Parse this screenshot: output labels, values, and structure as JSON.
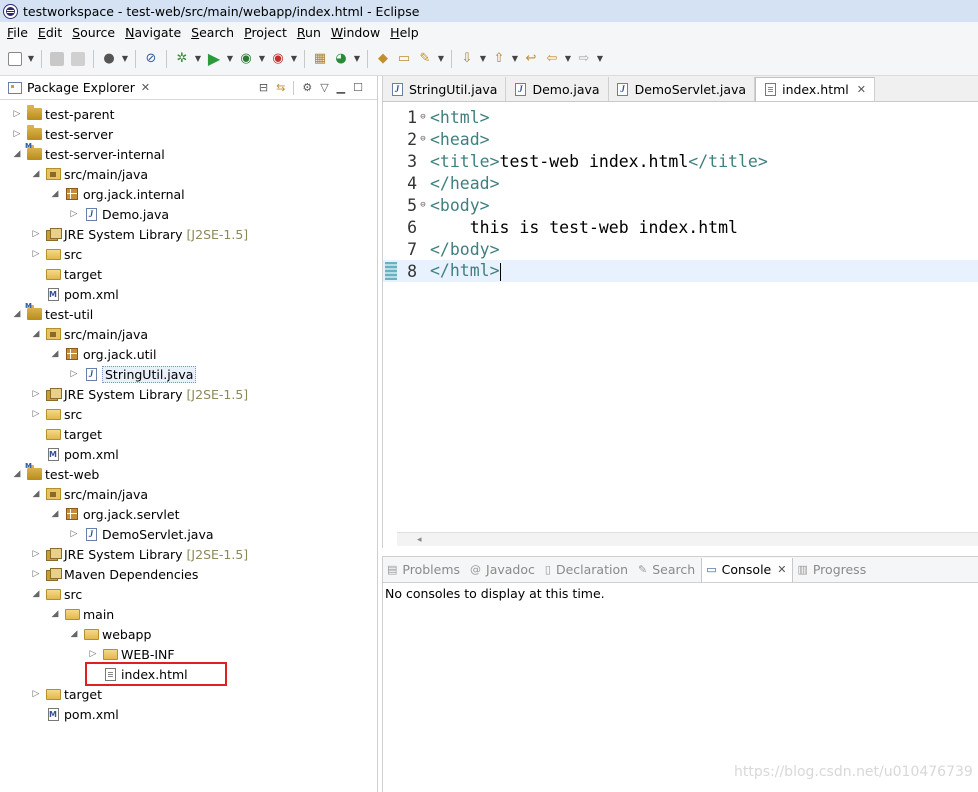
{
  "window": {
    "title": "testworkspace - test-web/src/main/webapp/index.html - Eclipse"
  },
  "menu": [
    {
      "underline": "F",
      "rest": "ile"
    },
    {
      "underline": "E",
      "rest": "dit"
    },
    {
      "underline": "S",
      "rest": "ource"
    },
    {
      "underline": "N",
      "rest": "avigate"
    },
    {
      "underline": "S",
      "rest": "earch"
    },
    {
      "underline": "P",
      "rest": "roject"
    },
    {
      "underline": "R",
      "rest": "un"
    },
    {
      "underline": "W",
      "rest": "indow"
    },
    {
      "underline": "H",
      "rest": "elp"
    }
  ],
  "package_explorer": {
    "title": "Package Explorer",
    "tree": [
      {
        "label": "test-parent",
        "depth": 0,
        "arrow": "collapsed",
        "icon": "project"
      },
      {
        "label": "test-server",
        "depth": 0,
        "arrow": "collapsed",
        "icon": "project"
      },
      {
        "label": "test-server-internal",
        "depth": 0,
        "arrow": "expanded",
        "icon": "maven-project"
      },
      {
        "label": "src/main/java",
        "depth": 1,
        "arrow": "expanded",
        "icon": "source-folder"
      },
      {
        "label": "org.jack.internal",
        "depth": 2,
        "arrow": "expanded",
        "icon": "package"
      },
      {
        "label": "Demo.java",
        "depth": 3,
        "arrow": "collapsed",
        "icon": "java-file"
      },
      {
        "label": "JRE System Library",
        "decoration": "[J2SE-1.5]",
        "depth": 1,
        "arrow": "collapsed",
        "icon": "library"
      },
      {
        "label": "src",
        "depth": 1,
        "arrow": "collapsed",
        "icon": "folder"
      },
      {
        "label": "target",
        "depth": 1,
        "arrow": "none",
        "icon": "folder"
      },
      {
        "label": "pom.xml",
        "depth": 1,
        "arrow": "none",
        "icon": "pom-file"
      },
      {
        "label": "test-util",
        "depth": 0,
        "arrow": "expanded",
        "icon": "maven-project"
      },
      {
        "label": "src/main/java",
        "depth": 1,
        "arrow": "expanded",
        "icon": "source-folder"
      },
      {
        "label": "org.jack.util",
        "depth": 2,
        "arrow": "expanded",
        "icon": "package"
      },
      {
        "label": "StringUtil.java",
        "depth": 3,
        "arrow": "collapsed",
        "icon": "java-file",
        "highlighted": true
      },
      {
        "label": "JRE System Library",
        "decoration": "[J2SE-1.5]",
        "depth": 1,
        "arrow": "collapsed",
        "icon": "library"
      },
      {
        "label": "src",
        "depth": 1,
        "arrow": "collapsed",
        "icon": "folder"
      },
      {
        "label": "target",
        "depth": 1,
        "arrow": "none",
        "icon": "folder"
      },
      {
        "label": "pom.xml",
        "depth": 1,
        "arrow": "none",
        "icon": "pom-file"
      },
      {
        "label": "test-web",
        "depth": 0,
        "arrow": "expanded",
        "icon": "maven-project"
      },
      {
        "label": "src/main/java",
        "depth": 1,
        "arrow": "expanded",
        "icon": "source-folder"
      },
      {
        "label": "org.jack.servlet",
        "depth": 2,
        "arrow": "expanded",
        "icon": "package"
      },
      {
        "label": "DemoServlet.java",
        "depth": 3,
        "arrow": "collapsed",
        "icon": "java-file"
      },
      {
        "label": "JRE System Library",
        "decoration": "[J2SE-1.5]",
        "depth": 1,
        "arrow": "collapsed",
        "icon": "library"
      },
      {
        "label": "Maven Dependencies",
        "depth": 1,
        "arrow": "collapsed",
        "icon": "library"
      },
      {
        "label": "src",
        "depth": 1,
        "arrow": "expanded",
        "icon": "folder"
      },
      {
        "label": "main",
        "depth": 2,
        "arrow": "expanded",
        "icon": "folder"
      },
      {
        "label": "webapp",
        "depth": 3,
        "arrow": "expanded",
        "icon": "folder"
      },
      {
        "label": "WEB-INF",
        "depth": 4,
        "arrow": "collapsed",
        "icon": "folder"
      },
      {
        "label": "index.html",
        "depth": 4,
        "arrow": "none",
        "icon": "html-file",
        "boxed": true
      },
      {
        "label": "target",
        "depth": 1,
        "arrow": "collapsed",
        "icon": "folder"
      },
      {
        "label": "pom.xml",
        "depth": 1,
        "arrow": "none",
        "icon": "pom-file"
      }
    ]
  },
  "editor": {
    "tabs": [
      {
        "label": "StringUtil.java",
        "active": false
      },
      {
        "label": "Demo.java",
        "active": false
      },
      {
        "label": "DemoServlet.java",
        "active": false
      },
      {
        "label": "index.html",
        "active": true
      }
    ],
    "lines": [
      {
        "num": "1",
        "fold": true,
        "parts": [
          {
            "t": "tag",
            "s": "<html>"
          }
        ]
      },
      {
        "num": "2",
        "fold": true,
        "parts": [
          {
            "t": "tag",
            "s": "<head>"
          }
        ]
      },
      {
        "num": "3",
        "fold": false,
        "parts": [
          {
            "t": "tag",
            "s": "<title>"
          },
          {
            "t": "txt",
            "s": "test-web index.html"
          },
          {
            "t": "tag",
            "s": "</title>"
          }
        ]
      },
      {
        "num": "4",
        "fold": false,
        "parts": [
          {
            "t": "tag",
            "s": "</head>"
          }
        ]
      },
      {
        "num": "5",
        "fold": true,
        "parts": [
          {
            "t": "tag",
            "s": "<body>"
          }
        ]
      },
      {
        "num": "6",
        "fold": false,
        "parts": [
          {
            "t": "txt",
            "s": "    this is test-web index.html"
          }
        ]
      },
      {
        "num": "7",
        "fold": false,
        "parts": [
          {
            "t": "tag",
            "s": "</body>"
          }
        ]
      },
      {
        "num": "8",
        "fold": false,
        "current": true,
        "parts": [
          {
            "t": "tag",
            "s": "</html>"
          }
        ]
      }
    ]
  },
  "bottom_panel": {
    "tabs": [
      {
        "label": "Problems",
        "icon": "problems-icon",
        "active": false
      },
      {
        "label": "Javadoc",
        "icon": "javadoc-icon",
        "active": false
      },
      {
        "label": "Declaration",
        "icon": "declaration-icon",
        "active": false
      },
      {
        "label": "Search",
        "icon": "search-icon",
        "active": false
      },
      {
        "label": "Console",
        "icon": "console-icon",
        "active": true
      },
      {
        "label": "Progress",
        "icon": "progress-icon",
        "active": false
      }
    ],
    "console_message": "No consoles to display at this time."
  },
  "watermark": "https://blog.csdn.net/u010476739"
}
